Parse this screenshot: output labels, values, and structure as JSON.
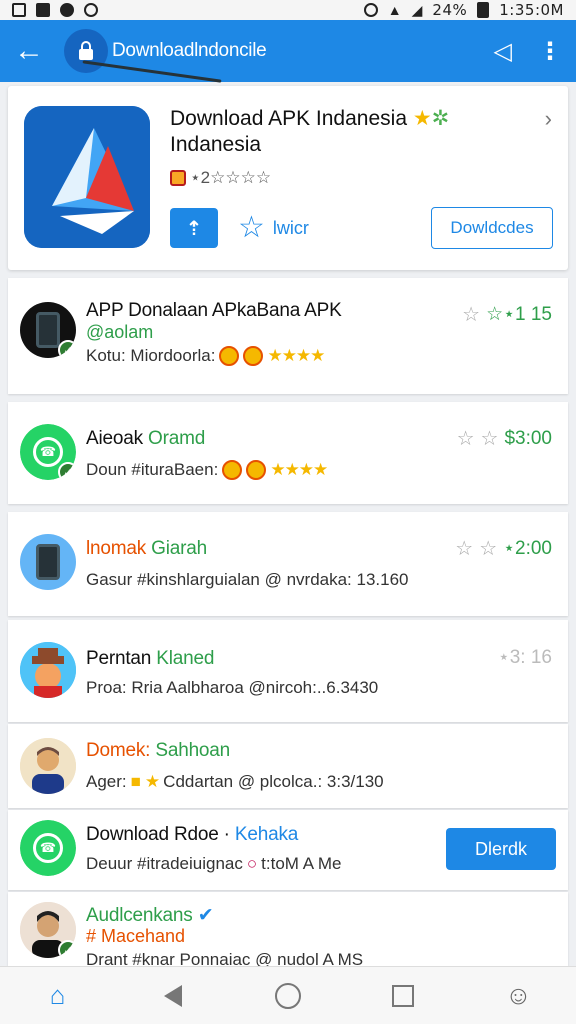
{
  "status_bar": {
    "battery": "24%",
    "time": "1:35:0M"
  },
  "app_bar": {
    "url": "Downloadlndoncile"
  },
  "hero": {
    "title_line1": "Download APK Indanesia",
    "title_line2": "Indanesia",
    "rating_text": "⋆2☆☆☆☆",
    "wish_label": "lwicr",
    "download_label": "Dowldcdes"
  },
  "items": [
    {
      "title": "APP Donalaan APkaBana APK",
      "subtitle": "@aolam",
      "meta": "Kotu: Miordoorla:",
      "right": "☆⋆1  15"
    },
    {
      "title": "Aieoak",
      "title_accent": "Oramd",
      "meta": "Doun #ituraBaen:",
      "right": "$3:00"
    },
    {
      "title": "lnomak",
      "title_accent": "Giarah",
      "meta": "Gasur #kinshlarguialan @ nvrdaka: 13.160",
      "right": "⋆2:00"
    },
    {
      "title": "Perntan",
      "title_accent": "Klaned",
      "meta": "Proa: Rria Aalbharoa @nircoh:..6.3430",
      "right": "⋆3: 16"
    },
    {
      "title": "Domek:",
      "title_accent": "Sahhoan",
      "meta": "Ager:",
      "meta2": "Cddartan @ plcolca.: 3:3/130"
    },
    {
      "title": "Download Rdoe ·",
      "title_accent": "Kehaka",
      "meta": "Deuur #itradeiuignac",
      "meta2": "t:toM A Me",
      "button": "Dlerdk"
    },
    {
      "title": "Audlcenkans",
      "subtitle": "# Macehand",
      "meta": "Drant #knar Ponnaiac @ nudol A MS"
    }
  ],
  "colors": {
    "primary": "#1e88e5",
    "green": "#2e9e4a",
    "gold": "#f5b800"
  }
}
